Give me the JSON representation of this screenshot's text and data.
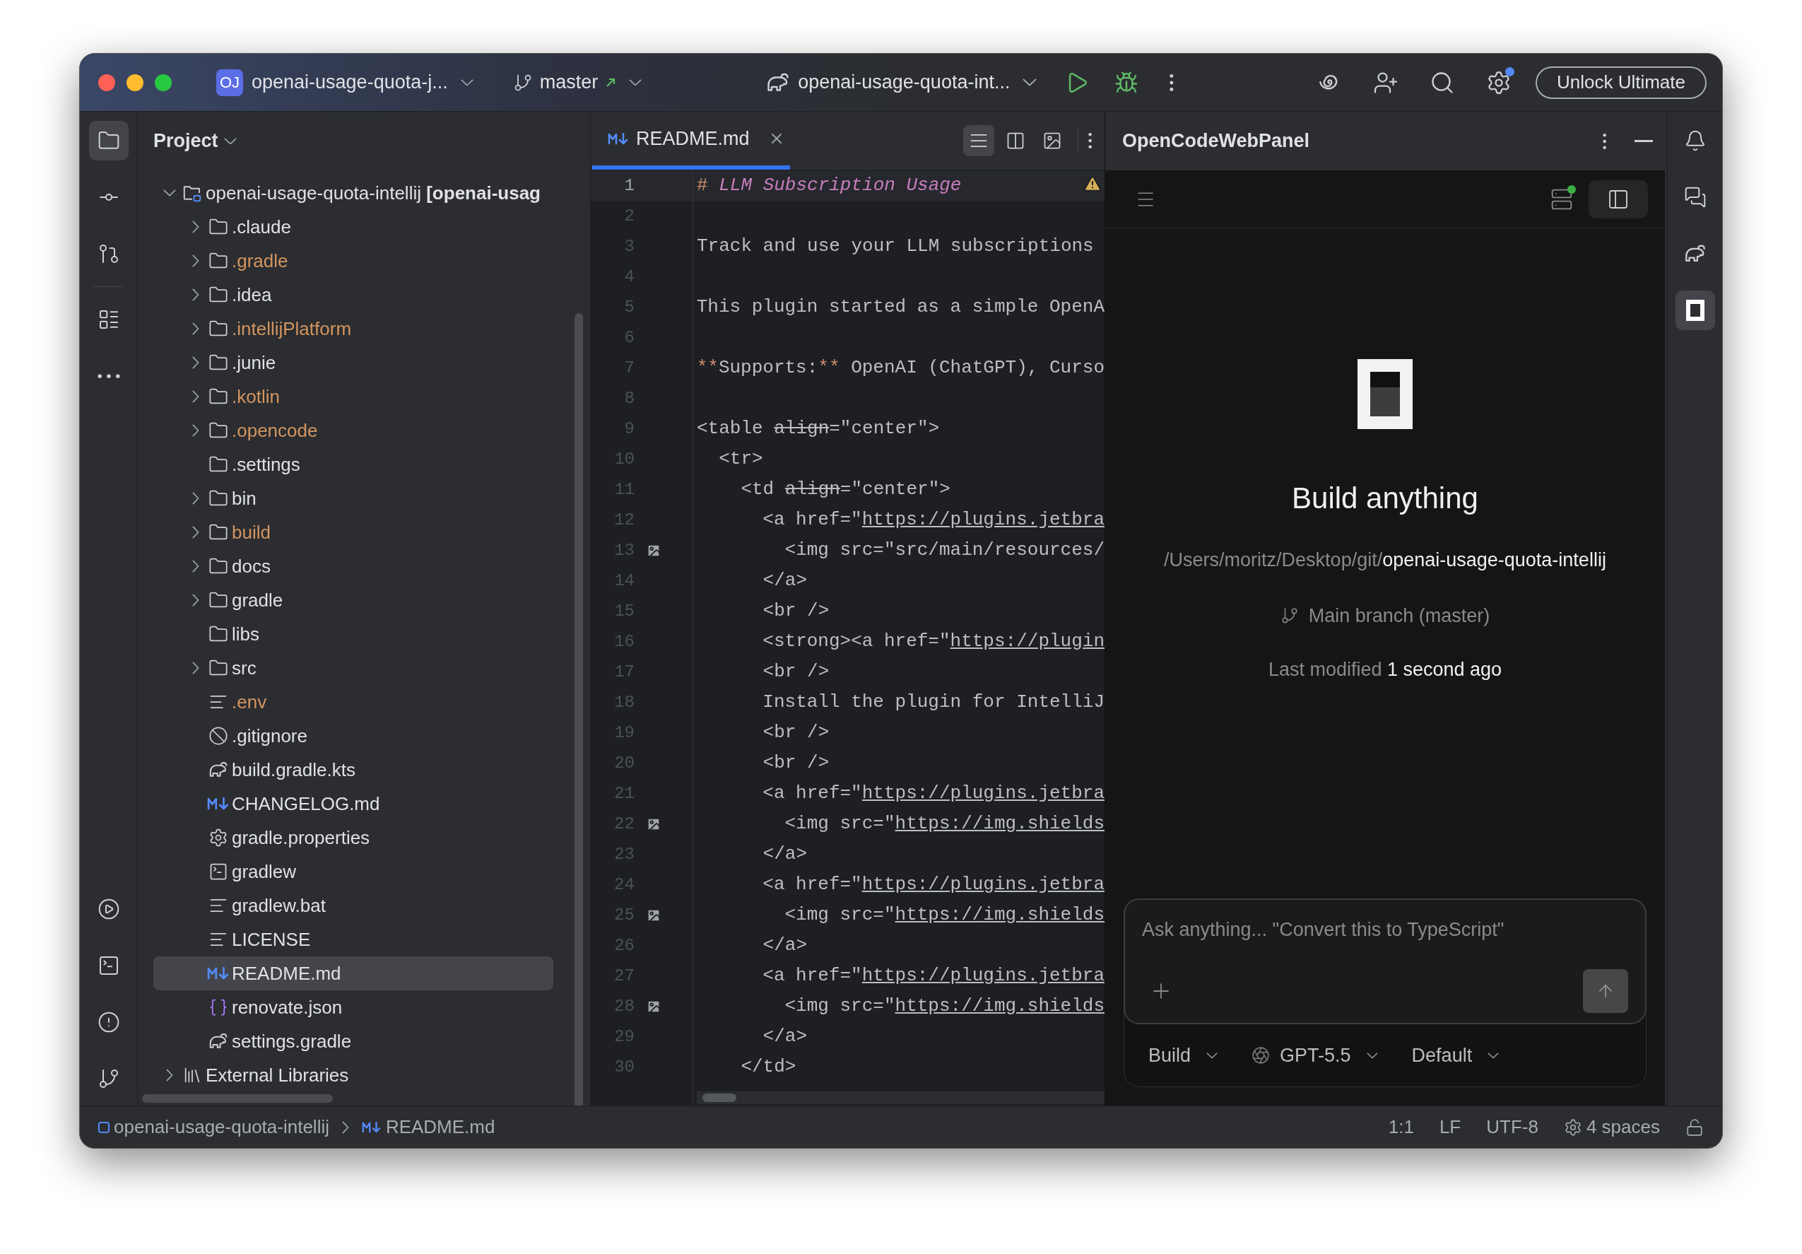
{
  "toolbar": {
    "project_badge": "OJ",
    "project": "openai-usage-quota-j...",
    "branch": "master",
    "run_config": "openai-usage-quota-int...",
    "settings_notification": true,
    "upgrade_button": "Unlock Ultimate"
  },
  "left_toolbar": {
    "top": [
      {
        "kind": "project",
        "selected": true
      },
      {
        "kind": "commit",
        "selected": false
      },
      {
        "kind": "pull_requests",
        "selected": false
      },
      {
        "kind": "structure",
        "selected": false
      },
      {
        "kind": "more",
        "selected": false
      }
    ],
    "bottom": [
      {
        "kind": "services",
        "selected": false
      },
      {
        "kind": "terminal",
        "selected": false
      },
      {
        "kind": "problems",
        "selected": false
      },
      {
        "kind": "git",
        "selected": false
      }
    ]
  },
  "right_toolbar": [
    {
      "kind": "notifications",
      "selected": false
    },
    {
      "kind": "ai_chat",
      "selected": false
    },
    {
      "kind": "gradle",
      "selected": false
    },
    {
      "kind": "opencode",
      "selected": true
    }
  ],
  "project_panel": {
    "title": "Project",
    "tree": [
      {
        "name": "openai-usage-quota-intellij **[openai-usag**",
        "kind": "module",
        "expanded": true,
        "ignored": false,
        "selected": false,
        "children": [
          {
            "name": ".claude",
            "kind": "folder",
            "expanded": false,
            "ignored": false,
            "selected": false
          },
          {
            "name": ".gradle",
            "kind": "folder",
            "expanded": false,
            "ignored": true,
            "selected": false
          },
          {
            "name": ".idea",
            "kind": "folder",
            "expanded": false,
            "ignored": false,
            "selected": false
          },
          {
            "name": ".intellijPlatform",
            "kind": "folder",
            "expanded": false,
            "ignored": true,
            "selected": false
          },
          {
            "name": ".junie",
            "kind": "folder",
            "expanded": false,
            "ignored": false,
            "selected": false
          },
          {
            "name": ".kotlin",
            "kind": "folder",
            "expanded": false,
            "ignored": true,
            "selected": false
          },
          {
            "name": ".opencode",
            "kind": "folder",
            "expanded": false,
            "ignored": true,
            "selected": false
          },
          {
            "name": ".settings",
            "kind": "folder",
            "ignored": false,
            "selected": false
          },
          {
            "name": "bin",
            "kind": "folder",
            "expanded": false,
            "ignored": false,
            "selected": false
          },
          {
            "name": "build",
            "kind": "folder",
            "expanded": false,
            "ignored": true,
            "selected": false
          },
          {
            "name": "docs",
            "kind": "folder",
            "expanded": false,
            "ignored": false,
            "selected": false
          },
          {
            "name": "gradle",
            "kind": "folder",
            "expanded": false,
            "ignored": false,
            "selected": false
          },
          {
            "name": "libs",
            "kind": "folder",
            "ignored": false,
            "selected": false
          },
          {
            "name": "src",
            "kind": "folder",
            "expanded": false,
            "ignored": false,
            "selected": false
          },
          {
            "name": ".env",
            "kind": "text",
            "ignored": true,
            "selected": false
          },
          {
            "name": ".gitignore",
            "kind": "gitignore",
            "ignored": false,
            "selected": false
          },
          {
            "name": "build.gradle.kts",
            "kind": "gradle_kts",
            "ignored": false,
            "selected": false
          },
          {
            "name": "CHANGELOG.md",
            "kind": "markdown",
            "ignored": false,
            "selected": false
          },
          {
            "name": "gradle.properties",
            "kind": "properties",
            "ignored": false,
            "selected": false
          },
          {
            "name": "gradlew",
            "kind": "shell",
            "ignored": false,
            "selected": false
          },
          {
            "name": "gradlew.bat",
            "kind": "text",
            "ignored": false,
            "selected": false
          },
          {
            "name": "LICENSE",
            "kind": "text",
            "ignored": false,
            "selected": false
          },
          {
            "name": "README.md",
            "kind": "markdown",
            "ignored": false,
            "selected": true
          },
          {
            "name": "renovate.json",
            "kind": "json",
            "ignored": false,
            "selected": false
          },
          {
            "name": "settings.gradle",
            "kind": "gradle",
            "ignored": false,
            "selected": false
          }
        ]
      },
      {
        "name": "External Libraries",
        "kind": "libraries",
        "expanded": false,
        "ignored": false,
        "selected": false
      }
    ]
  },
  "editor": {
    "tabs": [
      {
        "label": "README.md",
        "kind": "markdown",
        "selected": true
      }
    ],
    "view_modes": [
      {
        "kind": "editor",
        "selected": true
      },
      {
        "kind": "split",
        "selected": false
      },
      {
        "kind": "preview",
        "selected": false
      }
    ],
    "has_warning": true,
    "lines": [
      {
        "number": "1",
        "current": true,
        "preview": false,
        "segments": [
          {
            "kind": "markup",
            "text": "# "
          },
          {
            "kind": "heading",
            "text": "LLM Subscription Usage"
          }
        ]
      },
      {
        "number": "2",
        "current": false,
        "preview": false
      },
      {
        "number": "3",
        "current": false,
        "preview": false,
        "segments": [
          {
            "kind": "text",
            "text": "Track and use your LLM subscriptions"
          }
        ]
      },
      {
        "number": "4",
        "current": false,
        "preview": false
      },
      {
        "number": "5",
        "current": false,
        "preview": false,
        "segments": [
          {
            "kind": "text",
            "text": "This plugin started as a simple OpenA"
          }
        ]
      },
      {
        "number": "6",
        "current": false,
        "preview": false
      },
      {
        "number": "7",
        "current": false,
        "preview": false,
        "segments": [
          {
            "kind": "markup",
            "text": "**"
          },
          {
            "kind": "text",
            "text": "Supports:"
          },
          {
            "kind": "markup",
            "text": "**"
          },
          {
            "kind": "text",
            "text": " OpenAI (ChatGPT), Curso"
          }
        ]
      },
      {
        "number": "8",
        "current": false,
        "preview": false
      },
      {
        "number": "9",
        "current": false,
        "preview": false,
        "segments": [
          {
            "kind": "text",
            "text": "<table "
          },
          {
            "kind": "deprecated",
            "text": "align"
          },
          {
            "kind": "text",
            "text": "=\"center\">"
          }
        ]
      },
      {
        "number": "10",
        "current": false,
        "preview": false,
        "segments": [
          {
            "kind": "text",
            "text": "  <tr>"
          }
        ]
      },
      {
        "number": "11",
        "current": false,
        "preview": false,
        "segments": [
          {
            "kind": "text",
            "text": "    <td "
          },
          {
            "kind": "deprecated",
            "text": "align"
          },
          {
            "kind": "text",
            "text": "=\"center\">"
          }
        ]
      },
      {
        "number": "12",
        "current": false,
        "preview": false,
        "segments": [
          {
            "kind": "text",
            "text": "      <a href=\""
          },
          {
            "kind": "url",
            "text": "https://plugins.jetbra"
          }
        ]
      },
      {
        "number": "13",
        "current": false,
        "preview": true,
        "segments": [
          {
            "kind": "text",
            "text": "        <img src=\"src/main/resources/"
          }
        ]
      },
      {
        "number": "14",
        "current": false,
        "preview": false,
        "segments": [
          {
            "kind": "text",
            "text": "      </a>"
          }
        ]
      },
      {
        "number": "15",
        "current": false,
        "preview": false,
        "segments": [
          {
            "kind": "text",
            "text": "      <br />"
          }
        ]
      },
      {
        "number": "16",
        "current": false,
        "preview": false,
        "segments": [
          {
            "kind": "text",
            "text": "      <strong><a href=\""
          },
          {
            "kind": "url",
            "text": "https://plugin"
          }
        ]
      },
      {
        "number": "17",
        "current": false,
        "preview": false,
        "segments": [
          {
            "kind": "text",
            "text": "      <br />"
          }
        ]
      },
      {
        "number": "18",
        "current": false,
        "preview": false,
        "segments": [
          {
            "kind": "text",
            "text": "      Install the plugin for IntelliJ"
          }
        ]
      },
      {
        "number": "19",
        "current": false,
        "preview": false,
        "segments": [
          {
            "kind": "text",
            "text": "      <br />"
          }
        ]
      },
      {
        "number": "20",
        "current": false,
        "preview": false,
        "segments": [
          {
            "kind": "text",
            "text": "      <br />"
          }
        ]
      },
      {
        "number": "21",
        "current": false,
        "preview": false,
        "segments": [
          {
            "kind": "text",
            "text": "      <a href=\""
          },
          {
            "kind": "url",
            "text": "https://plugins.jetbra"
          }
        ]
      },
      {
        "number": "22",
        "current": false,
        "preview": true,
        "segments": [
          {
            "kind": "text",
            "text": "        <img src=\""
          },
          {
            "kind": "url",
            "text": "https://img.shields"
          }
        ]
      },
      {
        "number": "23",
        "current": false,
        "preview": false,
        "segments": [
          {
            "kind": "text",
            "text": "      </a>"
          }
        ]
      },
      {
        "number": "24",
        "current": false,
        "preview": false,
        "segments": [
          {
            "kind": "text",
            "text": "      <a href=\""
          },
          {
            "kind": "url",
            "text": "https://plugins.jetbra"
          }
        ]
      },
      {
        "number": "25",
        "current": false,
        "preview": true,
        "segments": [
          {
            "kind": "text",
            "text": "        <img src=\""
          },
          {
            "kind": "url",
            "text": "https://img.shields"
          }
        ]
      },
      {
        "number": "26",
        "current": false,
        "preview": false,
        "segments": [
          {
            "kind": "text",
            "text": "      </a>"
          }
        ]
      },
      {
        "number": "27",
        "current": false,
        "preview": false,
        "segments": [
          {
            "kind": "text",
            "text": "      <a href=\""
          },
          {
            "kind": "url",
            "text": "https://plugins.jetbra"
          }
        ]
      },
      {
        "number": "28",
        "current": false,
        "preview": true,
        "segments": [
          {
            "kind": "text",
            "text": "        <img src=\""
          },
          {
            "kind": "url",
            "text": "https://img.shields"
          }
        ]
      },
      {
        "number": "29",
        "current": false,
        "preview": false,
        "segments": [
          {
            "kind": "text",
            "text": "      </a>"
          }
        ]
      },
      {
        "number": "30",
        "current": false,
        "preview": false,
        "segments": [
          {
            "kind": "text",
            "text": "    </td>"
          }
        ]
      }
    ]
  },
  "opencode_panel": {
    "title": "OpenCodeWebPanel",
    "server_connected": true,
    "sidebar_open": true,
    "heading": "Build anything",
    "path_dir": "/Users/moritz/Desktop/git/",
    "path_name": "openai-usage-quota-intellij",
    "branch": "Main branch (master)",
    "modified_label": "Last modified",
    "modified_value": "1 second ago",
    "input_placeholder": "Ask anything... \"Convert this to TypeScript\"",
    "selectors": [
      {
        "label": "Build",
        "kind": "plain"
      },
      {
        "label": "GPT-5.5",
        "kind": "model"
      },
      {
        "label": "Default",
        "kind": "plain"
      }
    ]
  },
  "status_bar": {
    "breadcrumbs": [
      {
        "label": "openai-usage-quota-intellij",
        "kind": "module"
      },
      {
        "label": "README.md",
        "kind": "markdown"
      }
    ],
    "position": "1:1",
    "line_ending": "LF",
    "encoding": "UTF-8",
    "indent": "4 spaces",
    "locked": false
  }
}
